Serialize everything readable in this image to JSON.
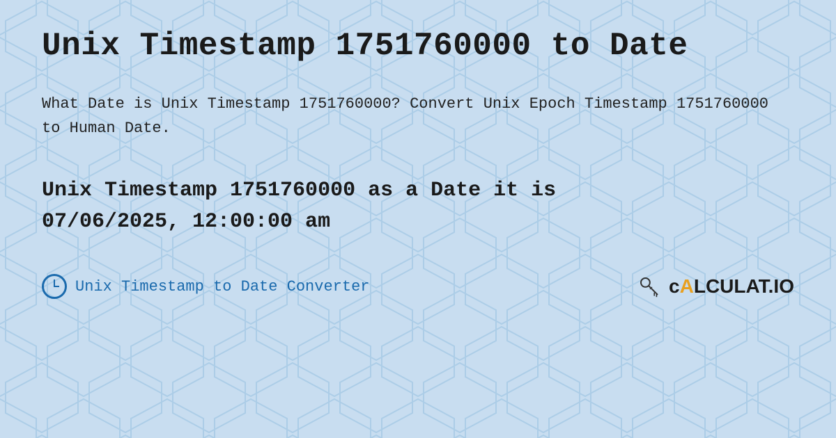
{
  "page": {
    "title": "Unix Timestamp 1751760000 to Date",
    "description": "What Date is Unix Timestamp 1751760000? Convert Unix Epoch Timestamp 1751760000 to Human Date.",
    "result_line1": "Unix Timestamp 1751760000 as a Date it is",
    "result_line2": "07/06/2025, 12:00:00 am",
    "footer": {
      "converter_label": "Unix Timestamp to Date Converter",
      "brand_name": "cALCULAT.IO"
    },
    "background_color": "#c8ddf0",
    "title_color": "#1a1a1a",
    "result_color": "#1a1a1a",
    "link_color": "#1a6aad"
  }
}
